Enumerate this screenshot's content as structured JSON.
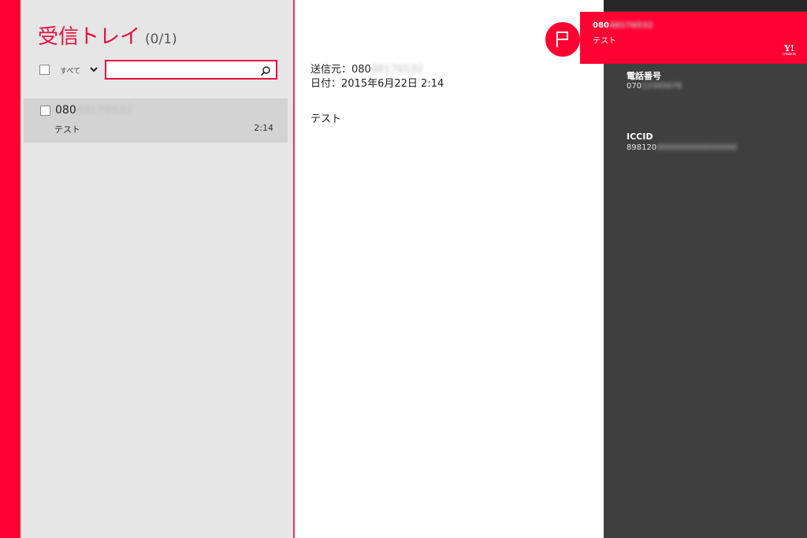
{
  "inbox": {
    "title": "受信トレイ",
    "count": "(0/1)",
    "select_all_label": "すべて",
    "search": {
      "placeholder": "",
      "value": ""
    },
    "messages": [
      {
        "sender_prefix": "080",
        "sender_redacted": "48176532",
        "preview": "テスト",
        "time": "2:14"
      }
    ]
  },
  "reader": {
    "from_label": "送信元：",
    "from_prefix": "080",
    "from_redacted": "48176532",
    "date_label": "日付：",
    "date_value": "2015年6月22日 2:14",
    "body": "テスト"
  },
  "info_panel": {
    "phone_label": "電話番号",
    "phone_prefix": "070",
    "phone_redacted": "12345678",
    "iccid_label": "ICCID",
    "iccid_prefix": "898120",
    "iccid_redacted": "0000000000000000"
  },
  "notification": {
    "sender_prefix": "080",
    "sender_redacted": "48176532",
    "message": "テスト",
    "logo_text": "Y!",
    "logo_sub": "mobile"
  },
  "colors": {
    "accent": "#ff0033",
    "left_pane_bg": "#e6e6e6",
    "selected_item_bg": "#d3d3d3",
    "right_panel_bg": "#3f3f3f"
  },
  "icons": [
    "search-icon",
    "chevron-down-icon",
    "flag-icon"
  ]
}
